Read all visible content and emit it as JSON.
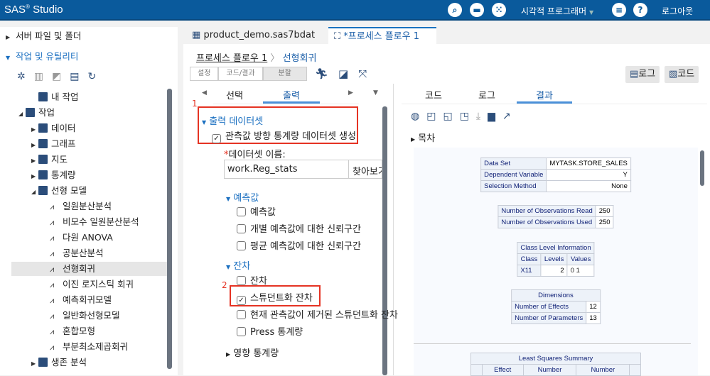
{
  "header": {
    "app": "SAS",
    "app_suffix": "Studio",
    "mode": "시각적 프로그래머",
    "logout": "로그아웃",
    "icons": [
      "search-icon",
      "folder-icon",
      "apps-icon",
      "menu-icon",
      "help-icon"
    ]
  },
  "left": {
    "server_files": "서버 파일 및 폴더",
    "tasks_utils": "작업 및 유틸리티",
    "tree": [
      {
        "label": "내 작업",
        "level": 1,
        "arrow": "",
        "kind": "folder"
      },
      {
        "label": "작업",
        "level": 0,
        "arrow": "open",
        "kind": "folder"
      },
      {
        "label": "데이터",
        "level": 1,
        "arrow": "closed",
        "kind": "folder"
      },
      {
        "label": "그래프",
        "level": 1,
        "arrow": "closed",
        "kind": "folder"
      },
      {
        "label": "지도",
        "level": 1,
        "arrow": "closed",
        "kind": "folder"
      },
      {
        "label": "통계량",
        "level": 1,
        "arrow": "closed",
        "kind": "folder"
      },
      {
        "label": "선형 모델",
        "level": 1,
        "arrow": "open",
        "kind": "folder"
      },
      {
        "label": "일원분산분석",
        "level": 2,
        "kind": "leaf"
      },
      {
        "label": "비모수 일원분산분석",
        "level": 2,
        "kind": "leaf"
      },
      {
        "label": "다원 ANOVA",
        "level": 2,
        "kind": "leaf"
      },
      {
        "label": "공분산분석",
        "level": 2,
        "kind": "leaf"
      },
      {
        "label": "선형회귀",
        "level": 2,
        "kind": "leaf",
        "selected": true
      },
      {
        "label": "이진 로지스틱 회귀",
        "level": 2,
        "kind": "leaf"
      },
      {
        "label": "예측회귀모델",
        "level": 2,
        "kind": "leaf"
      },
      {
        "label": "일반화선형모델",
        "level": 2,
        "kind": "leaf"
      },
      {
        "label": "혼합모형",
        "level": 2,
        "kind": "leaf"
      },
      {
        "label": "부분최소제곱회귀",
        "level": 2,
        "kind": "leaf"
      },
      {
        "label": "생존 분석",
        "level": 1,
        "arrow": "closed",
        "kind": "folder"
      }
    ]
  },
  "tabs": [
    {
      "label": "product_demo.sas7bdat",
      "close": "x"
    },
    {
      "label": "*프로세스 플로우 1",
      "close": "x"
    }
  ],
  "breadcrumb": {
    "root": "프로세스 플로우 1",
    "current": "선형회귀"
  },
  "toolbar": {
    "segments": [
      "설정",
      "코드/결과",
      "분할"
    ],
    "log_btn": "로그",
    "code_btn": "코드"
  },
  "options": {
    "tabs": [
      "선택",
      "출력"
    ],
    "output_dataset": {
      "title": "출력 데이터셋",
      "checkbox": "관측값 방향 통계량 데이터셋 생성",
      "checked": true,
      "name_label": "데이터셋 이름:",
      "name_value": "work.Reg_stats",
      "browse": "찾아보기"
    },
    "predicted": {
      "title": "예측값",
      "items": [
        {
          "label": "예측값",
          "checked": false
        },
        {
          "label": "개별 예측값에 대한 신뢰구간",
          "checked": false
        },
        {
          "label": "평균 예측값에 대한 신뢰구간",
          "checked": false
        }
      ]
    },
    "residual": {
      "title": "잔차",
      "items": [
        {
          "label": "잔차",
          "checked": false
        },
        {
          "label": "스튜던트화 잔차",
          "checked": true
        },
        {
          "label": "현재 관측값이 제거된 스튜던트화 잔차",
          "checked": false
        },
        {
          "label": "Press 통계량",
          "checked": false
        }
      ]
    },
    "influence": {
      "title": "영향 통계량"
    },
    "annotations": [
      "1",
      "2"
    ]
  },
  "results_panel": {
    "tabs": [
      "코드",
      "로그",
      "결과"
    ],
    "toc": "목차",
    "model_info": [
      [
        "Data Set",
        "MYTASK.STORE_SALES"
      ],
      [
        "Dependent Variable",
        "Y"
      ],
      [
        "Selection Method",
        "None"
      ]
    ],
    "obs": [
      [
        "Number of Observations Read",
        "250"
      ],
      [
        "Number of Observations Used",
        "250"
      ]
    ],
    "class_level": {
      "title": "Class Level Information",
      "headers": [
        "Class",
        "Levels",
        "Values"
      ],
      "rows": [
        [
          "X11",
          "2",
          "0 1"
        ]
      ]
    },
    "dimensions": {
      "title": "Dimensions",
      "rows": [
        [
          "Number of Effects",
          "12"
        ],
        [
          "Number of Parameters",
          "13"
        ]
      ]
    },
    "ls_summary": {
      "title": "Least Squares Summary",
      "headers": [
        "",
        "Effect",
        "Number",
        "Number",
        ""
      ]
    }
  }
}
